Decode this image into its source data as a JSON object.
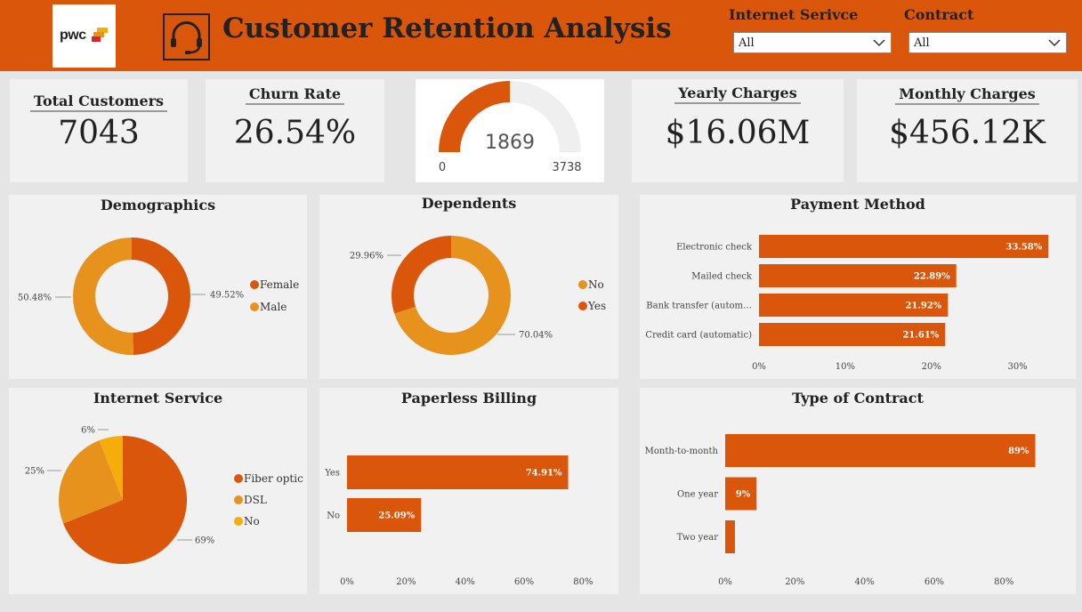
{
  "header": {
    "logo_text": "pwc",
    "title": "Customer Retention Analysis",
    "filters": [
      {
        "label": "Internet Serivce",
        "value": "All"
      },
      {
        "label": "Contract",
        "value": "All"
      }
    ]
  },
  "kpis": {
    "total_customers": {
      "label": "Total Customers",
      "value": "7043"
    },
    "churn_rate": {
      "label": "Churn Rate",
      "value": "26.54%"
    },
    "yearly_charges": {
      "label": "Yearly Charges",
      "value": "$16.06M"
    },
    "monthly_charges": {
      "label": "Monthly Charges",
      "value": "$456.12K"
    }
  },
  "colors": {
    "header": "#d9560a",
    "primary": "#d9560a",
    "secondary": "#e8921e",
    "tertiary": "#f5ad0c",
    "panel": "#f1f1f1",
    "background": "#e5e5e5"
  },
  "chart_data": [
    {
      "id": "gauge",
      "type": "gauge",
      "value": 1869,
      "min": 0,
      "max": 3738,
      "value_label": "1869",
      "min_label": "0",
      "max_label": "3738"
    },
    {
      "id": "demographics",
      "type": "pie",
      "title": "Demographics",
      "categories": [
        "Female",
        "Male"
      ],
      "values": [
        49.52,
        50.48
      ],
      "labels": [
        "49.52%",
        "50.48%"
      ],
      "donut": true,
      "legend": "right"
    },
    {
      "id": "dependents",
      "type": "pie",
      "title": "Dependents",
      "categories": [
        "No",
        "Yes"
      ],
      "values": [
        70.04,
        29.96
      ],
      "labels": [
        "70.04%",
        "29.96%"
      ],
      "donut": true,
      "legend": "right"
    },
    {
      "id": "payment",
      "type": "bar",
      "orientation": "horizontal",
      "title": "Payment Method",
      "categories": [
        "Electronic check",
        "Mailed check",
        "Bank transfer (autom…",
        "Credit card (automatic)"
      ],
      "values": [
        33.58,
        22.89,
        21.92,
        21.61
      ],
      "labels": [
        "33.58%",
        "22.89%",
        "21.92%",
        "21.61%"
      ],
      "xlim": [
        0,
        35
      ],
      "ticks": [
        0,
        10,
        20,
        30
      ],
      "tick_labels": [
        "0%",
        "10%",
        "20%",
        "30%"
      ]
    },
    {
      "id": "internet",
      "type": "pie",
      "title": "Internet Service",
      "categories": [
        "Fiber optic",
        "DSL",
        "No"
      ],
      "values": [
        69,
        25,
        6
      ],
      "labels": [
        "69%",
        "25%",
        "6%"
      ],
      "donut": false,
      "legend": "right"
    },
    {
      "id": "paperless",
      "type": "bar",
      "orientation": "horizontal",
      "title": "Paperless Billing",
      "categories": [
        "Yes",
        "No"
      ],
      "values": [
        74.91,
        25.09
      ],
      "labels": [
        "74.91%",
        "25.09%"
      ],
      "xlim": [
        0,
        85
      ],
      "ticks": [
        0,
        20,
        40,
        60,
        80
      ],
      "tick_labels": [
        "0%",
        "20%",
        "40%",
        "60%",
        "80%"
      ]
    },
    {
      "id": "contract",
      "type": "bar",
      "orientation": "horizontal",
      "title": "Type of Contract",
      "categories": [
        "Month-to-month",
        "One year",
        "Two year"
      ],
      "values": [
        89,
        9,
        2.8
      ],
      "labels": [
        "89%",
        "9%",
        ""
      ],
      "xlim": [
        0,
        95
      ],
      "ticks": [
        0,
        20,
        40,
        60,
        80
      ],
      "tick_labels": [
        "0%",
        "20%",
        "40%",
        "60%",
        "80%"
      ]
    }
  ]
}
